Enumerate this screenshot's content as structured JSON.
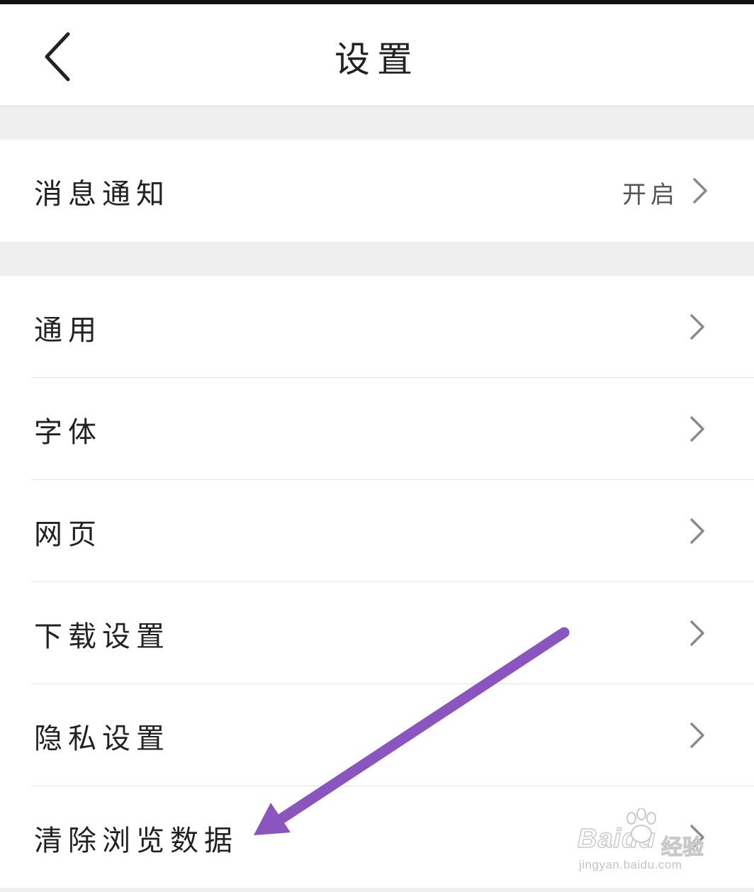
{
  "header": {
    "title": "设置",
    "back_icon": "chevron-left-icon"
  },
  "notification_row": {
    "label": "消息通知",
    "value": "开启"
  },
  "menu_items": [
    {
      "label": "通用"
    },
    {
      "label": "字体"
    },
    {
      "label": "网页"
    },
    {
      "label": "下载设置"
    },
    {
      "label": "隐私设置"
    },
    {
      "label": "清除浏览数据"
    }
  ],
  "annotation": {
    "arrow_color": "#8b55bf",
    "icon": "arrow-pointer-icon"
  },
  "watermark": {
    "brand": "Baidu",
    "sub": "经验",
    "url": "jingyan.baidu.com"
  },
  "colors": {
    "section_gap": "#efefef",
    "chevron": "#8a8a8a",
    "text": "#222222"
  }
}
